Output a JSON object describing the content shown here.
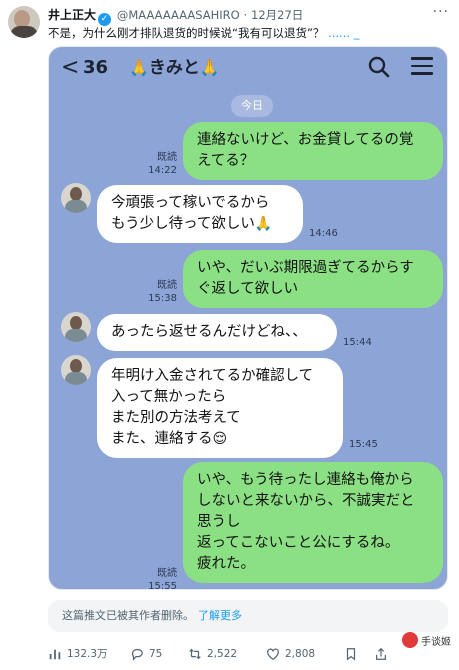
{
  "tweet": {
    "author_name": "井上正大",
    "handle": "@MAAAAAAASAHIRO",
    "separator": "·",
    "date": "12月27日",
    "text": "不是，为什么刚才排队退货的时候说“我有可以退货”？",
    "more": "...... _",
    "more_icon": "more-horizontal-icon",
    "verified": "✓"
  },
  "line_screenshot": {
    "back": "<",
    "unread_count": "36",
    "chat_title": "きみと",
    "title_emoji": "🙏",
    "day_label": "今日",
    "messages": [
      {
        "side": "me",
        "text": "連絡ないけど、お金貸してるの覚\nえてる？",
        "status": "既読",
        "time": "14:22"
      },
      {
        "side": "them",
        "text": "今頑張って稼いでるから\nもう少し待って欲しい",
        "emoji": "🙏",
        "time": "14:46"
      },
      {
        "side": "me",
        "text": "いや、だいぶ期限過ぎてるからす\nぐ返して欲しい",
        "status": "既読",
        "time": "15:38"
      },
      {
        "side": "them",
        "text": "あったら返せるんだけどね、、",
        "time": "15:44"
      },
      {
        "side": "them",
        "text": "年明け入金されてるか確認して\n入って無かったら\nまた別の方法考えて\nまた、連絡する",
        "emoji": "😌",
        "time": "15:45"
      },
      {
        "side": "me",
        "text": "いや、もう待ったし連絡も俺から\nしないと来ないから、不誠実だと\n思うし\n返ってこないこと公にするね。\n疲れた。",
        "status": "既読",
        "time": "15:55"
      }
    ]
  },
  "deleted_notice": {
    "text": "这篇推文已被其作者删除。",
    "learn_more": "了解更多"
  },
  "actions": {
    "views": "132.3万",
    "replies": "75",
    "retweets": "2,522",
    "likes": "2,808"
  },
  "watermark": {
    "label": "手谈姬"
  }
}
